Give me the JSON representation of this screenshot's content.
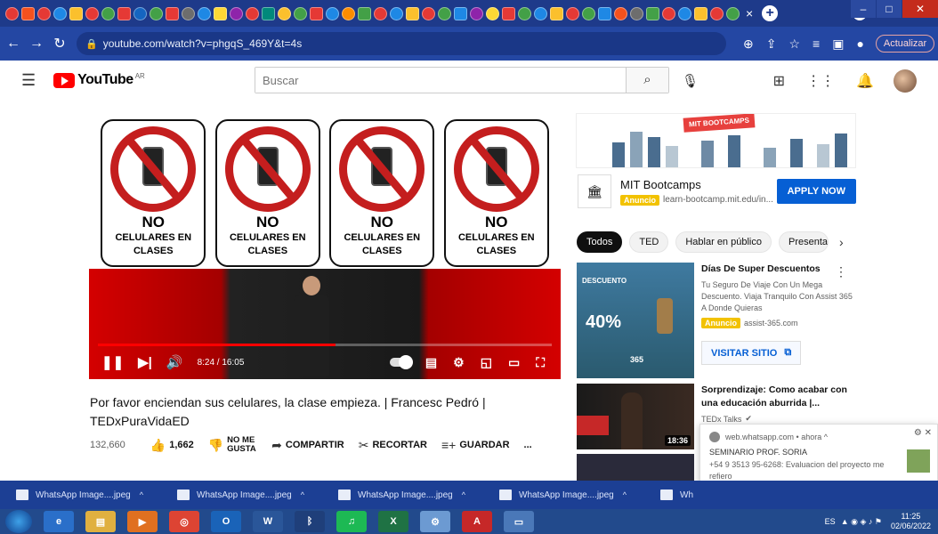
{
  "browser": {
    "url": "youtube.com/watch?v=phgqS_469Y&t=4s",
    "update_label": "Actualizar",
    "tab_close": "×",
    "new_tab": "+"
  },
  "youtube": {
    "logo_text": "YouTube",
    "region_code": "AR",
    "search_placeholder": "Buscar"
  },
  "video": {
    "signs": [
      {
        "no": "NO",
        "text": "CELULARES EN CLASES"
      },
      {
        "no": "NO",
        "text": "CELULARES EN CLASES"
      },
      {
        "no": "NO",
        "text": "CELULARES EN CLASES"
      },
      {
        "no": "NO",
        "text": "CELULARES EN CLASES"
      }
    ],
    "current_time": "8:24",
    "duration": "16:05",
    "time_display": "8:24 / 16:05",
    "progress_fraction": 0.523,
    "title": "Por favor enciendan sus celulares, la clase empieza. | Francesc Pedró | TEDxPuraVidaED",
    "views": "132,660",
    "likes": "1,662",
    "dislike_label": "NO ME GUSTA",
    "share_label": "COMPARTIR",
    "clip_label": "RECORTAR",
    "save_label": "GUARDAR",
    "more_label": "..."
  },
  "ad": {
    "banner_text": "MIT BOOTCAMPS",
    "name": "MIT Bootcamps",
    "badge": "Anuncio",
    "domain": "learn-bootcamp.mit.edu/in...",
    "cta": "APPLY NOW"
  },
  "chips": [
    "Todos",
    "TED",
    "Hablar en público",
    "Presenta"
  ],
  "suggestions": [
    {
      "title": "Días De Super Descuentos",
      "description": "Tu Seguro De Viaje Con Un Mega Descuento. Viaja Tranquilo Con Assist 365 A Donde Quieras",
      "badge": "Anuncio",
      "domain": "assist-365.com",
      "cta": "VISITAR SITIO",
      "thumb_label": "DESCUENTO",
      "thumb_percent": "40%",
      "thumb_brand": "365"
    },
    {
      "title": "Sorprendizaje: Como acabar con una educación aburrida |...",
      "channel": "TEDx Talks",
      "duration": "18:36"
    }
  ],
  "notification": {
    "source": "web.whatsapp.com • ahora ^",
    "title": "SEMINARIO PROF. SORIA",
    "message": "+54 9 3513 95-6268: Evaluacion del proyecto me refiero"
  },
  "downloads": [
    "WhatsApp Image....jpeg",
    "WhatsApp Image....jpeg",
    "WhatsApp Image....jpeg",
    "WhatsApp Image....jpeg",
    "Wh"
  ],
  "taskbar": {
    "lang": "ES",
    "time": "11:25",
    "date": "02/06/2022"
  },
  "colors": {
    "yt_red": "#ff0000",
    "sign_red": "#c41e1e",
    "apply_blue": "#065fd4",
    "ad_badge": "#f2c200"
  }
}
